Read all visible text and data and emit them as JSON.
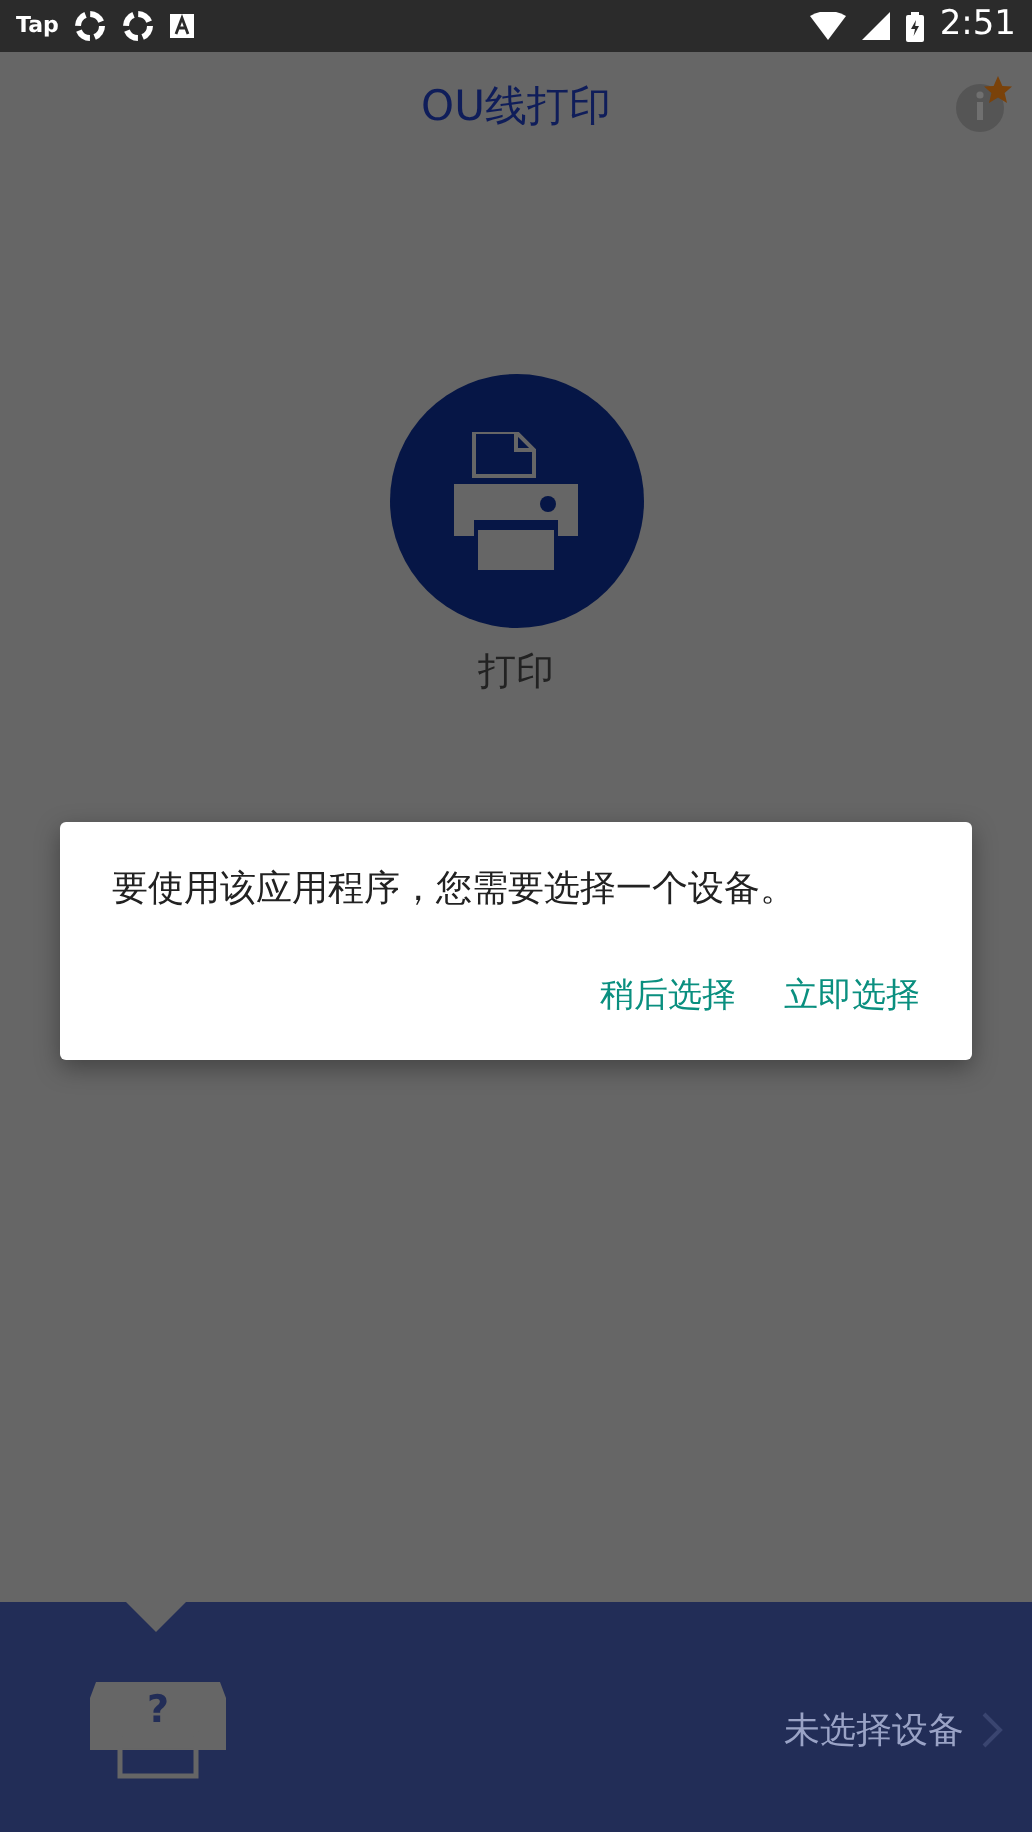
{
  "status_bar": {
    "app_label": "Tap",
    "time": "2:51"
  },
  "app_bar": {
    "title": "OU线打印"
  },
  "main_action": {
    "label": "打印"
  },
  "dialog": {
    "message": "要使用该应用程序，您需要选择一个设备。",
    "buttons": [
      "稍后选择",
      "立即选择"
    ]
  },
  "bottom_bar": {
    "printer_mark": "?",
    "device_status": "未选择设备"
  }
}
